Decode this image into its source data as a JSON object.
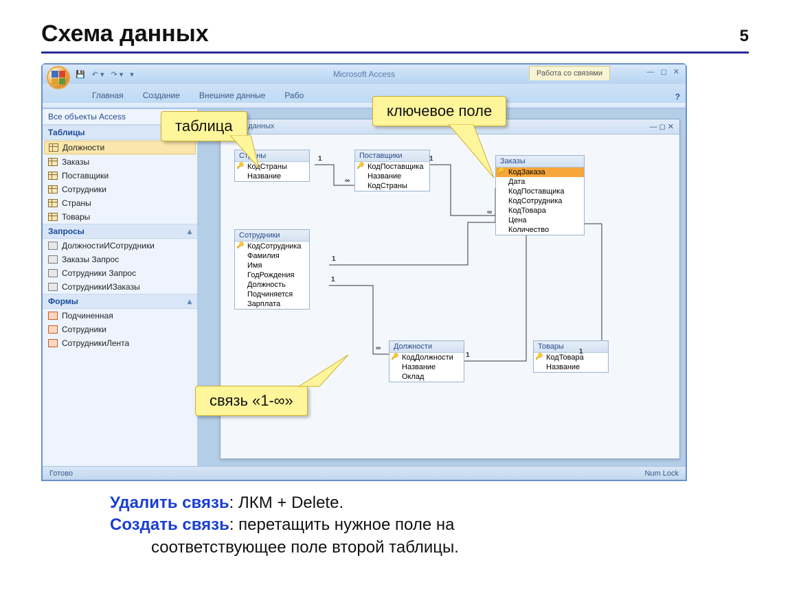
{
  "slide": {
    "title": "Схема данных",
    "page": "5"
  },
  "app": {
    "title": "Microsoft Access",
    "context_tab": "Работа со связями",
    "ribbon_tabs": [
      "Главная",
      "Создание",
      "Внешние данные",
      "Рабо"
    ],
    "nav_title": "Все объекты Access",
    "mdi_title": "данных",
    "win_controls": "— ◻ ✕",
    "mdi_controls": "— ◻ ✕",
    "help": "?"
  },
  "nav": {
    "groups": [
      {
        "title": "Таблицы",
        "items": [
          "Должности",
          "Заказы",
          "Поставщики",
          "Сотрудники",
          "Страны",
          "Товары"
        ],
        "icon": "table",
        "selected": 0
      },
      {
        "title": "Запросы",
        "items": [
          "ДолжностиИСотрудники",
          "Заказы Запрос",
          "Сотрудники Запрос",
          "СотрудникиИЗаказы"
        ],
        "icon": "query"
      },
      {
        "title": "Формы",
        "items": [
          "Подчиненная",
          "Сотрудники",
          "СотрудникиЛента"
        ],
        "icon": "form"
      }
    ]
  },
  "tables": {
    "countries": {
      "title": "Страны",
      "fields": [
        "КодСтраны",
        "Название"
      ],
      "keys": [
        0
      ]
    },
    "suppliers": {
      "title": "Поставщики",
      "fields": [
        "КодПоставщика",
        "Название",
        "КодСтраны"
      ],
      "keys": [
        0
      ]
    },
    "orders": {
      "title": "Заказы",
      "fields": [
        "КодЗаказа",
        "Дата",
        "КодПоставщика",
        "КодСотрудника",
        "КодТовара",
        "Цена",
        "Количество"
      ],
      "keys": [
        0
      ],
      "selected": 0
    },
    "employees": {
      "title": "Сотрудники",
      "fields": [
        "КодСотрудника",
        "Фамилия",
        "Имя",
        "ГодРождения",
        "Должность",
        "Подчиняется",
        "Зарплата"
      ],
      "keys": [
        0
      ]
    },
    "positions": {
      "title": "Должности",
      "fields": [
        "КодДолжности",
        "Название",
        "Оклад"
      ],
      "keys": [
        0
      ]
    },
    "goods": {
      "title": "Товары",
      "fields": [
        "КодТовара",
        "Название"
      ],
      "keys": [
        0
      ]
    }
  },
  "rel_marks": {
    "one": "1",
    "many": "∞"
  },
  "callouts": {
    "table": "таблица",
    "keyfield": "ключевое поле",
    "relation": "связь «1-∞»"
  },
  "status": {
    "left": "Готово",
    "right": "Num Lock"
  },
  "notes": {
    "l1a": "Удалить связь",
    "l1b": ": ЛКМ + Delete.",
    "l2a": "Создать связь",
    "l2b": ": перетащить нужное поле на",
    "l3": "соответствующее поле второй таблицы."
  }
}
